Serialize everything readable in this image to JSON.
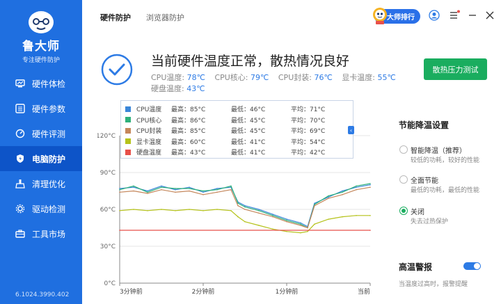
{
  "app": {
    "name": "鲁大师",
    "subtitle": "专注硬件防护",
    "version": "6.1024.3990.402"
  },
  "sidebar": {
    "items": [
      {
        "label": "硬件体检",
        "icon": "monitor-icon",
        "active": false
      },
      {
        "label": "硬件参数",
        "icon": "list-icon",
        "active": false
      },
      {
        "label": "硬件评测",
        "icon": "gauge-icon",
        "active": false
      },
      {
        "label": "电脑防护",
        "icon": "shield-icon",
        "active": true
      },
      {
        "label": "清理优化",
        "icon": "broom-icon",
        "active": false
      },
      {
        "label": "驱动检测",
        "icon": "gear-icon",
        "active": false
      },
      {
        "label": "工具市场",
        "icon": "toolbox-icon",
        "active": false
      }
    ]
  },
  "tabs": [
    {
      "label": "硬件防护",
      "active": true
    },
    {
      "label": "浏览器防护",
      "active": false
    }
  ],
  "header": {
    "master_label": "大师排行"
  },
  "status": {
    "headline": "当前硬件温度正常，散热情况良好",
    "temps": [
      {
        "label": "CPU温度:",
        "value": "78℃"
      },
      {
        "label": "CPU核心:",
        "value": "79℃"
      },
      {
        "label": "CPU封装:",
        "value": "76℃"
      },
      {
        "label": "显卡温度:",
        "value": "55℃"
      },
      {
        "label": "硬盘温度:",
        "value": "43℃"
      }
    ],
    "stress_button": "散热压力测试"
  },
  "legend": [
    {
      "name": "CPU温度",
      "max": "最高：85°C",
      "min": "最低：46°C",
      "avg": "平均：71°C",
      "color": "#3a86d8"
    },
    {
      "name": "CPU核心",
      "max": "最高：86°C",
      "min": "最低：45°C",
      "avg": "平均：70°C",
      "color": "#2db07a"
    },
    {
      "name": "CPU封装",
      "max": "最高：85°C",
      "min": "最低：45°C",
      "avg": "平均：69°C",
      "color": "#c5865a"
    },
    {
      "name": "显卡温度",
      "max": "最高：60°C",
      "min": "最低：41°C",
      "avg": "平均：54°C",
      "color": "#b5c21a"
    },
    {
      "name": "硬盘温度",
      "max": "最高：43°C",
      "min": "最低：41°C",
      "avg": "平均：42°C",
      "color": "#e8504a"
    }
  ],
  "chart_data": {
    "type": "line",
    "x_ticks": [
      "3分钟前",
      "2分钟前",
      "1分钟前",
      "当前"
    ],
    "y_ticks": [
      "0°C",
      "30°C",
      "60°C",
      "90°C",
      "120°C"
    ],
    "ylim": [
      0,
      120
    ],
    "xlim": [
      0,
      180
    ],
    "series": [
      {
        "name": "CPU温度",
        "color": "#3a86d8",
        "x": [
          0,
          10,
          20,
          30,
          40,
          50,
          60,
          70,
          80,
          85,
          90,
          100,
          110,
          120,
          130,
          135,
          140,
          150,
          160,
          170,
          180
        ],
        "y": [
          77,
          78,
          75,
          79,
          76,
          78,
          74,
          77,
          78,
          66,
          63,
          60,
          56,
          52,
          49,
          46,
          65,
          70,
          75,
          78,
          80
        ]
      },
      {
        "name": "CPU核心",
        "color": "#2db07a",
        "x": [
          0,
          10,
          20,
          30,
          40,
          50,
          60,
          70,
          80,
          85,
          90,
          100,
          110,
          120,
          130,
          135,
          140,
          150,
          160,
          170,
          180
        ],
        "y": [
          76,
          79,
          74,
          78,
          77,
          77,
          75,
          76,
          79,
          65,
          62,
          59,
          55,
          51,
          48,
          45,
          64,
          71,
          74,
          79,
          81
        ]
      },
      {
        "name": "CPU封装",
        "color": "#c5865a",
        "x": [
          0,
          10,
          20,
          30,
          40,
          50,
          60,
          70,
          80,
          85,
          90,
          100,
          110,
          120,
          130,
          135,
          140,
          150,
          160,
          170,
          180
        ],
        "y": [
          74,
          75,
          73,
          76,
          74,
          75,
          72,
          74,
          76,
          63,
          60,
          57,
          54,
          50,
          47,
          45,
          63,
          69,
          72,
          76,
          78
        ]
      },
      {
        "name": "显卡温度",
        "color": "#b5c21a",
        "x": [
          0,
          10,
          20,
          30,
          40,
          50,
          60,
          70,
          80,
          85,
          90,
          100,
          110,
          120,
          130,
          135,
          140,
          150,
          160,
          170,
          180
        ],
        "y": [
          59,
          60,
          59,
          60,
          59,
          60,
          59,
          60,
          59,
          54,
          50,
          47,
          44,
          42,
          41,
          42,
          48,
          52,
          54,
          55,
          55
        ]
      },
      {
        "name": "硬盘温度",
        "color": "#e8504a",
        "x": [
          0,
          180
        ],
        "y": [
          43,
          43
        ]
      }
    ]
  },
  "settings": {
    "title": "节能降温设置",
    "options": [
      {
        "label": "智能降温（推荐）",
        "desc": "较低的功耗，较好的性能",
        "selected": false
      },
      {
        "label": "全面节能",
        "desc": "最低的功耗，最低的性能",
        "selected": false
      },
      {
        "label": "关闭",
        "desc": "失去过热保护",
        "selected": true
      }
    ],
    "alarm_title": "高温警报",
    "alarm_desc": "当温度过高时，报警提醒",
    "alarm_on": true
  }
}
